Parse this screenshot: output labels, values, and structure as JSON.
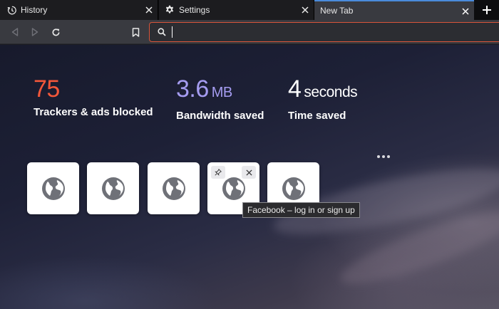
{
  "tabs": [
    {
      "label": "History",
      "icon": "history-icon"
    },
    {
      "label": "Settings",
      "icon": "gear-icon"
    },
    {
      "label": "New Tab",
      "icon": ""
    }
  ],
  "toolbar": {
    "url_value": "",
    "accent_color": "#d9553a"
  },
  "stats": [
    {
      "value": "75",
      "unit": "",
      "caption": "Trackers & ads blocked",
      "color": "#f3573a"
    },
    {
      "value": "3.6",
      "unit": "MB",
      "caption": "Bandwidth saved",
      "color": "#a59cf1"
    },
    {
      "value": "4",
      "unit": "seconds",
      "caption": "Time saved",
      "color": "#ffffff"
    }
  ],
  "top_sites": [
    {
      "icon": "globe-icon"
    },
    {
      "icon": "globe-icon"
    },
    {
      "icon": "globe-icon"
    },
    {
      "icon": "globe-icon",
      "hovered": true,
      "tooltip": "Facebook – log in or sign up"
    },
    {
      "icon": "globe-icon"
    }
  ],
  "tooltip": "Facebook – log in or sign up"
}
